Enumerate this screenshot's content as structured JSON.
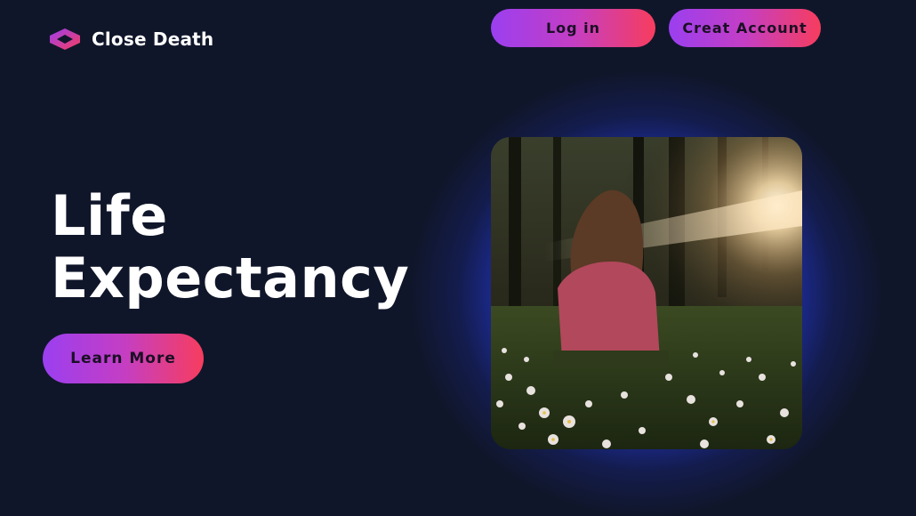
{
  "header": {
    "brand": "Close Death",
    "logo_icon": "cube-logo-icon",
    "login_label": "Log in",
    "create_account_label": "Creat Account"
  },
  "hero": {
    "title_line1": "Life",
    "title_line2": "Expectancy",
    "cta_label": "Learn More",
    "image_alt": "girl-sitting-in-flower-meadow-image"
  },
  "colors": {
    "background": "#10162a",
    "gradient_start": "#9b3ff0",
    "gradient_end": "#f73d5e",
    "glow": "#2640e8"
  }
}
